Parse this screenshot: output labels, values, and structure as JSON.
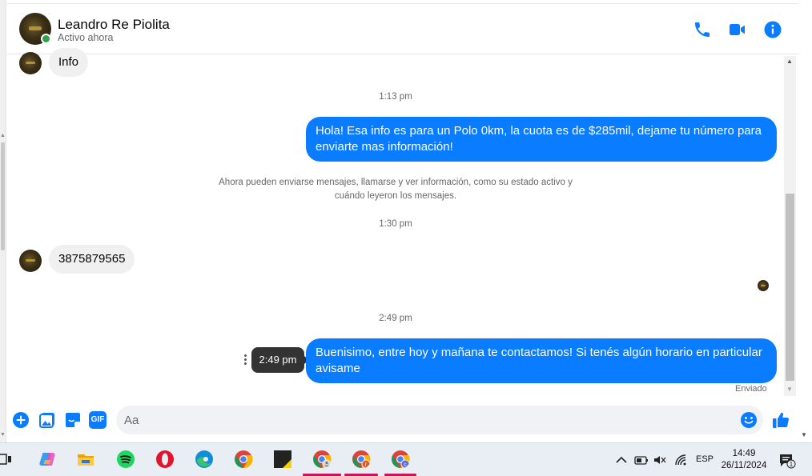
{
  "header": {
    "contact_name": "Leandro Re Piolita",
    "status": "Activo ahora",
    "icons": [
      "phone-icon",
      "video-icon",
      "info-icon"
    ],
    "accent": "#0a7cff"
  },
  "messages": [
    {
      "from": "contact",
      "text": "Info"
    },
    {
      "type": "timestamp",
      "text": "1:13 pm"
    },
    {
      "from": "me",
      "text": "Hola! Esa info es para un Polo 0km, la cuota es de $285mil, dejame tu número para enviarte mas información!"
    },
    {
      "type": "system",
      "text": "Ahora pueden enviarse mensajes, llamarse y ver información, como su estado activo y cuándo leyeron los mensajes."
    },
    {
      "type": "timestamp",
      "text": "1:30 pm"
    },
    {
      "from": "contact",
      "text": "3875879565"
    },
    {
      "type": "timestamp",
      "text": "2:49 pm"
    },
    {
      "from": "me",
      "text": "Buenisimo, entre hoy y mañana te contactamos! Si tenés algún horario en particular avisame"
    }
  ],
  "tooltip": "2:49 pm",
  "sent_status": "Enviado",
  "composer": {
    "placeholder": "Aa",
    "icons": [
      "add-icon",
      "image-icon",
      "sticker-icon",
      "gif-icon",
      "emoji-icon",
      "like-icon"
    ],
    "gif_label": "GIF"
  },
  "taskbar": {
    "apps": [
      "task-view-icon",
      "copilot-icon",
      "file-explorer-icon",
      "spotify-icon",
      "opera-icon",
      "edge-icon",
      "chrome-icon",
      "sticky-notes-icon",
      "chrome-profile-1-icon",
      "chrome-profile-r-icon",
      "chrome-profile-c-icon"
    ],
    "profile_badges": [
      "r",
      "c"
    ],
    "tray": {
      "language": "ESP",
      "time": "14:49",
      "date": "26/11/2024",
      "notifications": "1"
    }
  }
}
